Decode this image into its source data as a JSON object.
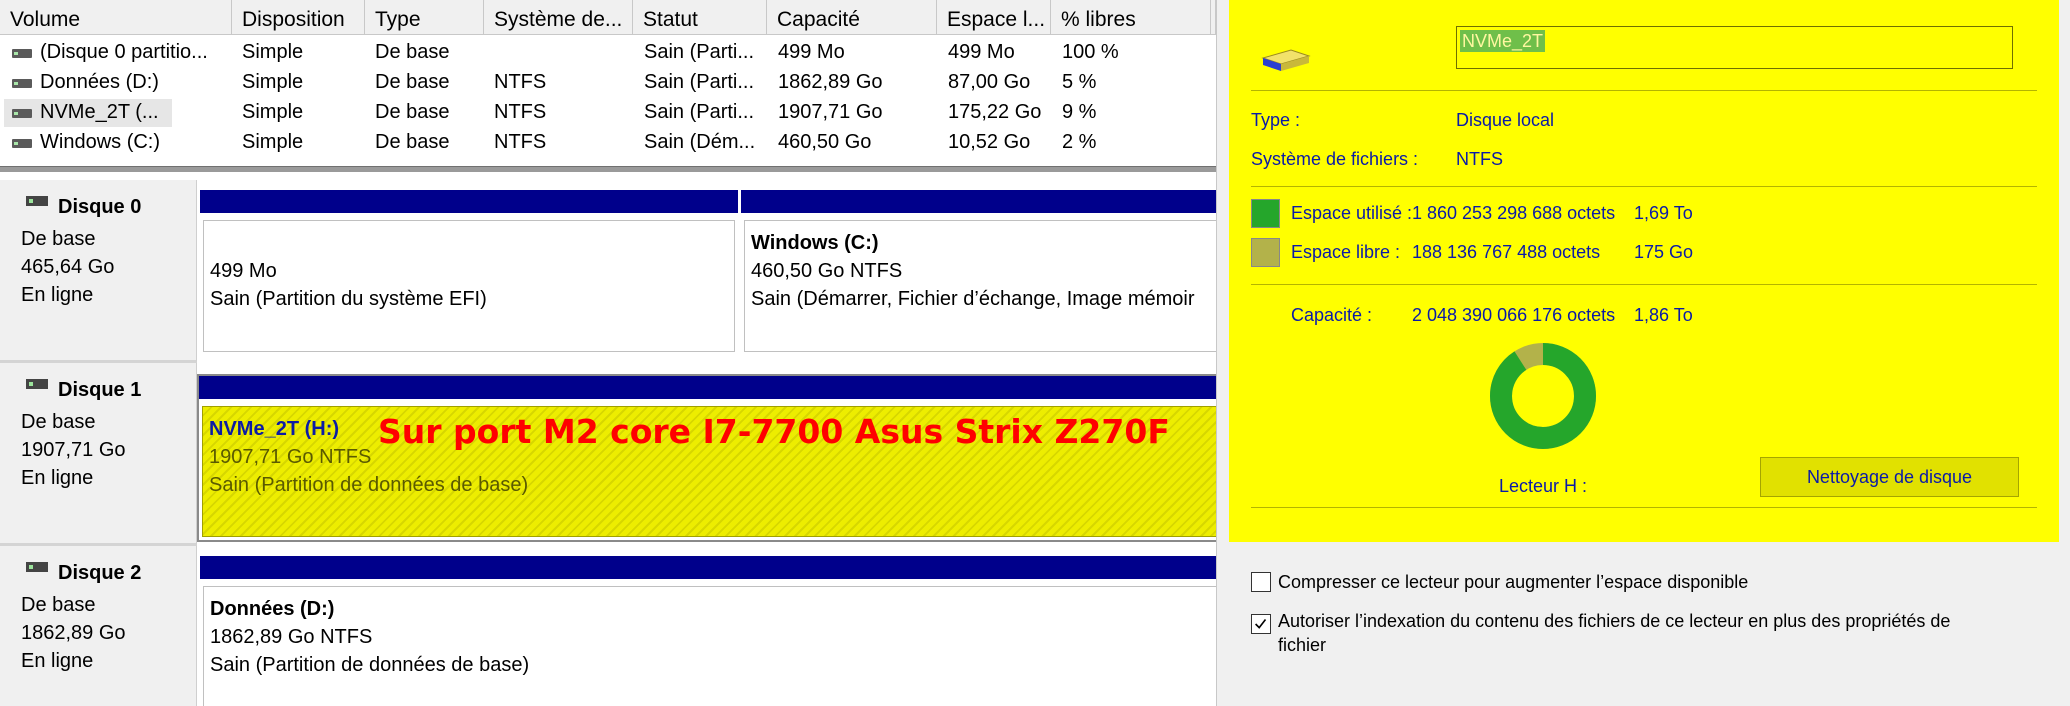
{
  "columns": [
    "Volume",
    "Disposition",
    "Type",
    "Système de...",
    "Statut",
    "Capacité",
    "Espace l...",
    "% libres"
  ],
  "volumes": [
    {
      "volume": "(Disque 0 partitio...",
      "disposition": "Simple",
      "type": "De base",
      "fs": "",
      "status": "Sain (Parti...",
      "capacity": "499 Mo",
      "free": "499 Mo",
      "pct": "100 %"
    },
    {
      "volume": "Données (D:)",
      "disposition": "Simple",
      "type": "De base",
      "fs": "NTFS",
      "status": "Sain (Parti...",
      "capacity": "1862,89 Go",
      "free": "87,00 Go",
      "pct": "5 %"
    },
    {
      "volume": "NVMe_2T (...",
      "disposition": "Simple",
      "type": "De base",
      "fs": "NTFS",
      "status": "Sain (Parti...",
      "capacity": "1907,71 Go",
      "free": "175,22 Go",
      "pct": "9 %"
    },
    {
      "volume": "Windows (C:)",
      "disposition": "Simple",
      "type": "De base",
      "fs": "NTFS",
      "status": "Sain (Dém...",
      "capacity": "460,50 Go",
      "free": "10,52 Go",
      "pct": "2 %"
    }
  ],
  "disks": [
    {
      "name": "Disque 0",
      "kind": "De base",
      "size": "465,64 Go",
      "state": "En ligne",
      "partitions": [
        {
          "title": "",
          "line1": "499 Mo",
          "line2": "Sain (Partition du système EFI)"
        },
        {
          "title": "Windows  (C:)",
          "line1": "460,50 Go NTFS",
          "line2": "Sain (Démarrer, Fichier d’échange, Image mémoir"
        }
      ]
    },
    {
      "name": "Disque 1",
      "kind": "De base",
      "size": "1907,71 Go",
      "state": "En ligne",
      "partitions": [
        {
          "title": "NVMe_2T  (H:)",
          "line1": "1907,71 Go NTFS",
          "line2": "Sain (Partition de données de base)"
        }
      ]
    },
    {
      "name": "Disque 2",
      "kind": "De base",
      "size": "1862,89 Go",
      "state": "En ligne",
      "partitions": [
        {
          "title": "Données  (D:)",
          "line1": "1862,89 Go NTFS",
          "line2": "Sain (Partition de données de base)"
        }
      ]
    }
  ],
  "annotation": "Sur port M2 core I7-7700 Asus Strix Z270F",
  "properties": {
    "drive_name": "NVMe_2T",
    "type_label": "Type :",
    "type_value": "Disque local",
    "fs_label": "Système de fichiers :",
    "fs_value": "NTFS",
    "used_label": "Espace utilisé :",
    "used_bytes": "1 860 253 298 688 octets",
    "used_human": "1,69 To",
    "free_label": "Espace libre :",
    "free_bytes": "188 136 767 488 octets",
    "free_human": "175 Go",
    "capacity_label": "Capacité :",
    "capacity_bytes": "2 048 390 066 176 octets",
    "capacity_human": "1,86 To",
    "drive_letter_label": "Lecteur H :",
    "cleanup_button": "Nettoyage de disque",
    "used_fraction": 0.908
  },
  "options": {
    "compress_label": "Compresser ce lecteur pour augmenter l’espace disponible",
    "compress_checked": false,
    "index_label_1": "Autoriser l’indexation du contenu des fichiers de ce lecteur en plus des propriétés de",
    "index_label_2": "fichier",
    "index_checked": true
  },
  "colors": {
    "used": "#25a62b",
    "free": "#b3b24a",
    "dialog_bg": "#ffff00",
    "partition_bar": "#00008b",
    "annotation": "#ff0000"
  }
}
